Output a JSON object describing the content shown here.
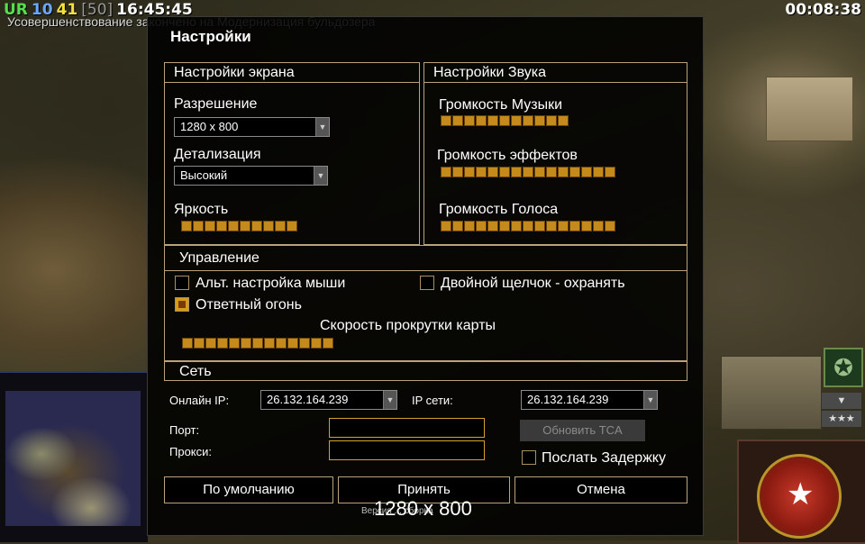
{
  "hud": {
    "faction": "UR",
    "num_a": "10",
    "num_b": "41",
    "num_c": "[50]",
    "clock": "16:45:45",
    "timer": "00:08:38",
    "message": "Усовершенствование закончено на Модернизация бульдозера"
  },
  "dialog": {
    "title": "Настройки",
    "screen": {
      "header": "Настройки экрана",
      "resolution_label": "Разрешение",
      "resolution_value": "1280 x 800",
      "detail_label": "Детализация",
      "detail_value": "Высокий",
      "brightness_label": "Яркость",
      "brightness_level": 10
    },
    "sound": {
      "header": "Настройки Звука",
      "music_label": "Громкость Музыки",
      "music_level": 11,
      "effects_label": "Громкость эффектов",
      "effects_level": 15,
      "voice_label": "Громкость Голоса",
      "voice_level": 15
    },
    "control": {
      "header": "Управление",
      "alt_mouse_label": "Альт. настройка мыши",
      "alt_mouse_checked": false,
      "double_click_label": "Двойной щелчок - охранять",
      "double_click_checked": false,
      "retaliation_label": "Ответный огонь",
      "retaliation_checked": true,
      "scroll_label": "Скорость прокрутки карты",
      "scroll_level": 13
    },
    "network": {
      "header": "Сеть",
      "online_ip_label": "Онлайн IP:",
      "online_ip_value": "26.132.164.239",
      "lan_ip_label": "IP сети:",
      "lan_ip_value": "26.132.164.239",
      "port_label": "Порт:",
      "port_value": "",
      "proxy_label": "Прокси:",
      "proxy_value": "",
      "update_button": "Обновить TCA",
      "lag_label": "Послать Задержку",
      "lag_checked": false
    },
    "buttons": {
      "default": "По умолчанию",
      "accept": "Принять",
      "cancel": "Отмена"
    },
    "version_text": "Версия ... сборка",
    "overlay_resolution": "1280 x 800"
  },
  "colors": {
    "slider": "#c58a1c",
    "frame": "#b9a37a",
    "field_border": "#d4a030",
    "hud_green": "#54e04a",
    "hud_blue": "#6aa8ff",
    "hud_yellow": "#f0e040",
    "hud_gray": "#9a9a9a"
  }
}
